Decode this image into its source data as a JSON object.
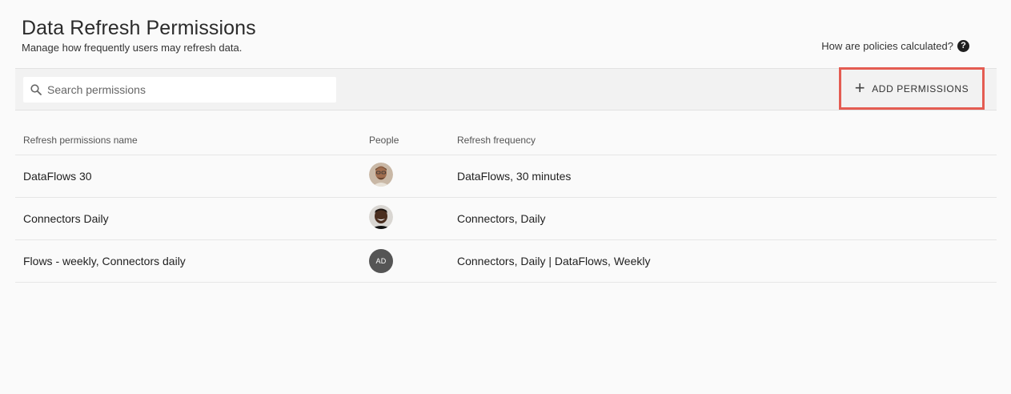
{
  "header": {
    "title": "Data Refresh Permissions",
    "subtitle": "Manage how frequently users may refresh data.",
    "help_link": "How are policies calculated?",
    "help_icon": "question-circle-icon"
  },
  "toolbar": {
    "search_placeholder": "Search permissions",
    "search_value": "",
    "add_button_label": "ADD PERMISSIONS",
    "highlight_color": "#e45c52"
  },
  "table": {
    "columns": [
      "Refresh permissions name",
      "People",
      "Refresh frequency"
    ],
    "rows": [
      {
        "name": "DataFlows 30",
        "avatar": "photo-avatar-1",
        "frequency": "DataFlows, 30 minutes"
      },
      {
        "name": "Connectors Daily",
        "avatar": "photo-avatar-2",
        "frequency": "Connectors, Daily"
      },
      {
        "name": "Flows - weekly, Connectors daily",
        "avatar_initials": "AD",
        "frequency": "Connectors, Daily | DataFlows, Weekly"
      }
    ]
  }
}
